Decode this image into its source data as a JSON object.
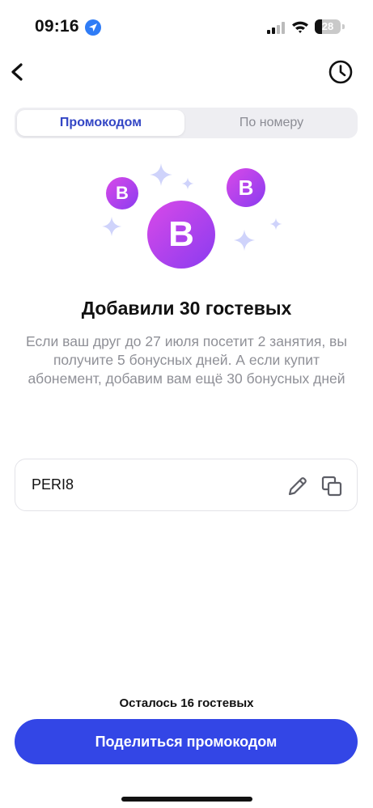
{
  "status_bar": {
    "time": "09:16",
    "location_icon": "location-arrow-icon",
    "battery_level": "28",
    "battery_fraction": 0.28,
    "icons": [
      "cellular-signal-icon",
      "wifi-icon",
      "battery-icon"
    ]
  },
  "header": {
    "back_icon": "chevron-left-icon",
    "history_icon": "clock-icon"
  },
  "tabs": [
    {
      "label": "Промокодом",
      "active": true
    },
    {
      "label": "По номеру",
      "active": false
    }
  ],
  "illustration": {
    "badge_letter": "B",
    "gradient_from": "#d949e8",
    "gradient_to": "#8a3cf0",
    "sparkle_color": "#cfd3fb"
  },
  "headline": "Добавили 30 гостевых",
  "description": "Если ваш друг до 27 июля посетит 2 занятия, вы получите 5 бонусных дней. А если купит абонемент, добавим вам ещё 30 бонусных дней",
  "promo_code": {
    "value": "PERI8",
    "edit_icon": "pencil-icon",
    "copy_icon": "copy-icon"
  },
  "remaining_text": "Осталось 16 гостевых",
  "share_button_label": "Поделиться промокодом",
  "colors": {
    "accent": "#3346e6",
    "tab_active_text": "#3346c5",
    "muted_text": "#8f9097"
  }
}
